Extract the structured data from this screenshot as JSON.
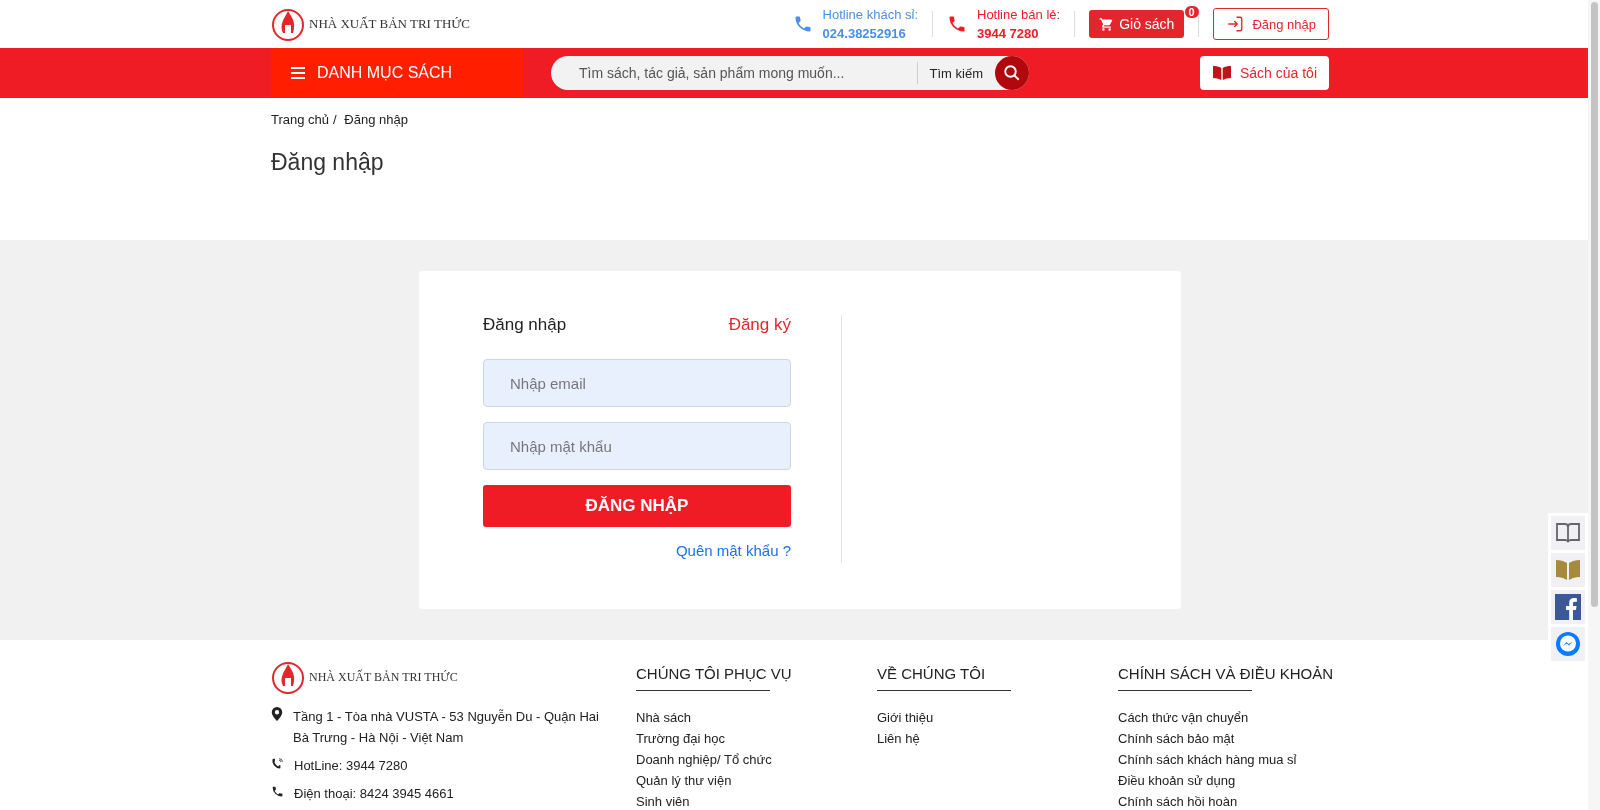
{
  "header": {
    "brand": "NHÀ XUẤT BẢN TRI THỨC",
    "hotlines": [
      {
        "label": "Hotline khách sỉ:",
        "number": "024.38252916",
        "color": "#4a90e2"
      },
      {
        "label": "Hotline bán lẻ:",
        "number": "3944 7280",
        "color": "#ee1c25"
      }
    ],
    "cart": {
      "label": "Giỏ sách",
      "count": "0"
    },
    "login": "Đăng nhập"
  },
  "navbar": {
    "menu": "DANH MỤC SÁCH",
    "search": {
      "placeholder": "Tìm sách, tác giả, sản phẩm mong muốn...",
      "button": "Tìm kiếm"
    },
    "my_books": "Sách của tôi"
  },
  "breadcrumb": {
    "items": [
      "Trang chủ",
      "Đăng nhập"
    ],
    "separator": "/"
  },
  "page_title": "Đăng nhập",
  "login_form": {
    "tabs": [
      {
        "label": "Đăng nhập",
        "selected": true
      },
      {
        "label": "Đăng ký",
        "selected": false
      }
    ],
    "email": {
      "placeholder": "Nhập email"
    },
    "password": {
      "placeholder": "Nhập mật khẩu"
    },
    "submit": "ĐĂNG NHẬP",
    "forgot": "Quên mật khẩu ?"
  },
  "footer": {
    "brand": "NHÀ XUẤT BẢN TRI THỨC",
    "contacts": [
      {
        "kind": "address",
        "text": "Tầng 1 - Tòa nhà VUSTA - 53 Nguyễn Du - Quận Hai Bà Trưng - Hà Nội - Việt Nam"
      },
      {
        "kind": "hotline",
        "text": "HotLine: 3944 7280"
      },
      {
        "kind": "phone",
        "text": "Điện thoại: 8424 3945 4661"
      }
    ],
    "columns": [
      {
        "title": "CHÚNG TÔI PHỤC VỤ",
        "links": [
          "Nhà sách",
          "Trường đại học",
          "Doanh nghiệp/ Tổ chức",
          "Quản lý thư viện",
          "Sinh viên"
        ]
      },
      {
        "title": "VỀ CHÚNG TÔI",
        "links": [
          "Giới thiệu",
          "Liên hệ"
        ]
      },
      {
        "title": "CHÍNH SÁCH VÀ ĐIỀU KHOẢN",
        "links": [
          "Cách thức vận chuyển",
          "Chính sách bảo mật",
          "Chính sách khách hàng mua sỉ",
          "Điều khoản sử dụng",
          "Chính sách hồi hoàn"
        ]
      }
    ]
  }
}
